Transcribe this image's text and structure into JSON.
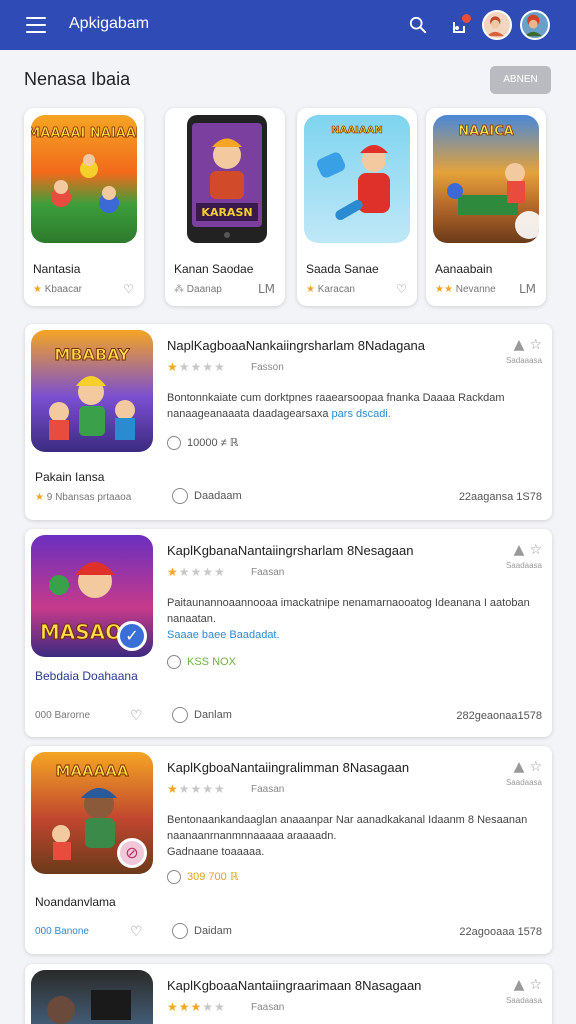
{
  "header": {
    "title": "Apkigabam",
    "accent": "#2f4bb5"
  },
  "section": {
    "title": "Nenasa Ibaia",
    "button_label": "ABNEN"
  },
  "featured": [
    {
      "art_text": "MAAAAI NAIAAI",
      "name": "Nantasia",
      "meta": "Kbaacar",
      "end_icon": "heart-icon",
      "stars": 1
    },
    {
      "art_text": "KARASN",
      "name": "Kanan Saodae",
      "meta": "Daanap",
      "end_icon": "LM",
      "stars": 0
    },
    {
      "art_text": "NAAIAAN",
      "name": "Saada Sanae",
      "meta": "Karacan",
      "end_icon": "heart-icon",
      "stars": 1
    },
    {
      "art_text": "NAAICA",
      "name": "Aanaabain",
      "meta": "Nevanne",
      "end_icon": "LM",
      "stars": 2
    }
  ],
  "list_items": [
    {
      "title": "NaplKagboaaNankaiingrsharlam 8Nadagana",
      "stars_on": 1,
      "rating_label": "Fasson",
      "side_label": "Sadaaasa",
      "desc_line1": "Bontonnkaiate cum dorktpnes raaearsoopaa fnanka Daaaa Rackdam",
      "desc_line2_a": "nanaageanaaata daadagearsaxa",
      "desc_line2_b": "pars dscadi.",
      "tag": "10000 ≠ ℝ",
      "tag_color": "#e0a020",
      "left_name": "Pakain Iansa",
      "left_meta": "9 Nbansas prtaaoa",
      "bottom_mid": "Daadaam",
      "bottom_right": "22aagansa 1S78",
      "art_text": "MBABAY"
    },
    {
      "title": "KaplKgbanaNantaiingrsharlam 8Nesagaan",
      "stars_on": 1,
      "rating_label": "Faasan",
      "side_label": "Saadaasa",
      "desc_line1": "Paitaunannoaannooaa imackatnipe nenamarnaooatog Ideanana I aatoban",
      "desc_line2_a": "nanaatan.",
      "desc_line2_b": "Saaae baee Baadadat.",
      "tag": "KSS NOX",
      "tag_color": "#6db33f",
      "left_name": "Bebdaia Doahaana",
      "left_meta": "000 Barorne",
      "bottom_mid": "Danlam",
      "bottom_right": "282geaonaa1578",
      "art_text": "MASAO"
    },
    {
      "title": "KaplKgboaNantaiingralimman 8Nasagaan",
      "stars_on": 1,
      "rating_label": "Faasan",
      "side_label": "Saadaasa",
      "desc_line1": "Bentonaankandaaglan anaaanpar Nar aanadkakanal Idaanm 8 Nesaanan",
      "desc_line2_a": "naanaanrnanmnnaaaaa araaaadn.",
      "desc_line2_b": "Gadnaane toaaaaa.",
      "tag": "309 700 ℝ",
      "tag_color": "#e0a020",
      "left_name": "Noandanvlama",
      "left_meta": "000 Banone",
      "bottom_mid": "Daidam",
      "bottom_right": "22agooaaa 1578",
      "art_text": "MAAAAA"
    },
    {
      "title": "KaplKgboaaNantaiingraarimaan 8Nasagaan",
      "stars_on": 3,
      "rating_label": "Faasan",
      "side_label": "Saadaasa"
    }
  ]
}
